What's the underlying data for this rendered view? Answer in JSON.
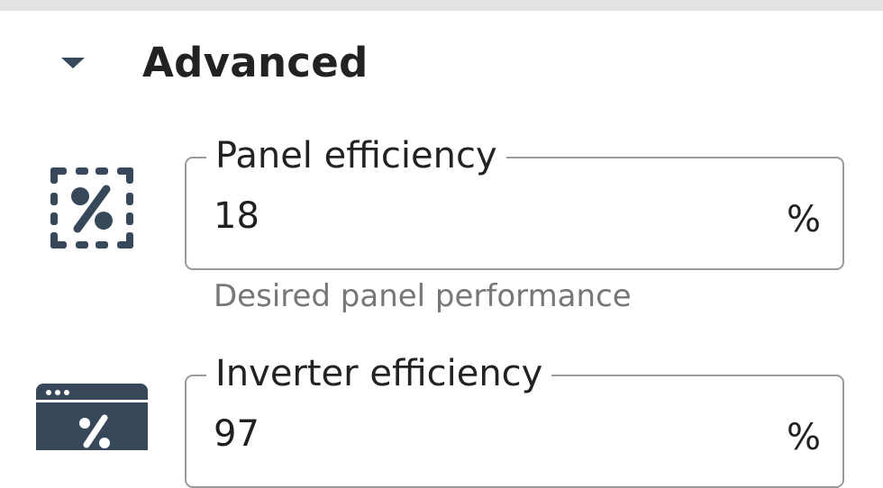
{
  "section": {
    "title": "Advanced",
    "icon": "chevron-down-icon",
    "expanded": true
  },
  "fields": [
    {
      "icon": "dashed-percent-icon",
      "label": "Panel efficiency",
      "value": "18",
      "suffix": "%",
      "helper": "Desired panel performance"
    },
    {
      "icon": "window-percent-icon",
      "label": "Inverter efficiency",
      "value": "97",
      "suffix": "%"
    }
  ],
  "colors": {
    "icon": "#36485a",
    "outline": "#9a9a9a",
    "helper_text": "#777777",
    "top_bar": "#e3e3e3"
  }
}
